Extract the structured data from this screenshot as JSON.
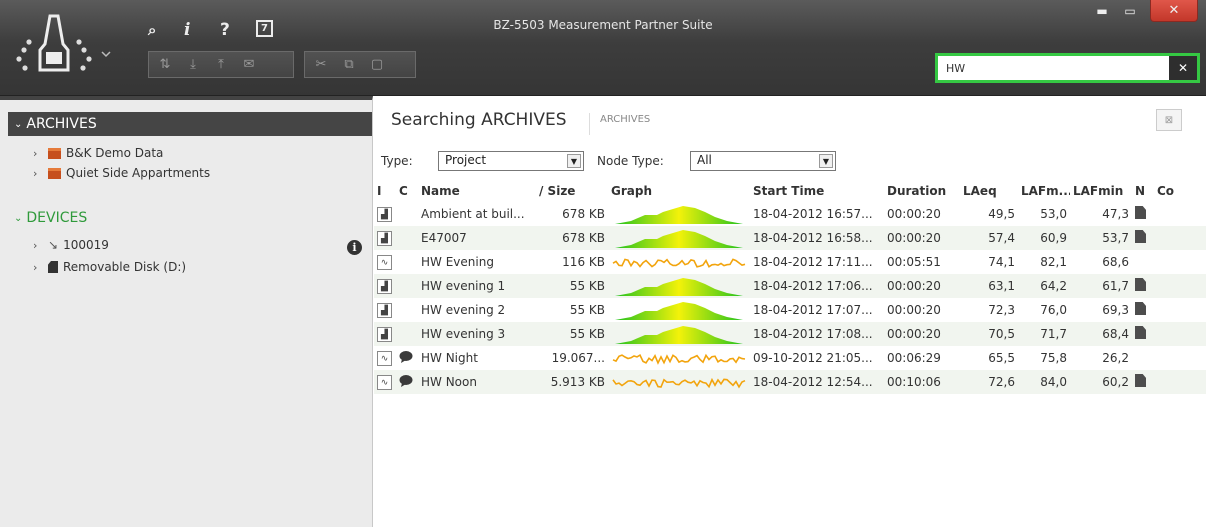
{
  "window": {
    "title": "BZ-5503 Measurement Partner Suite",
    "min_label": "‒",
    "max_label": "▫",
    "close_label": "✕"
  },
  "titlebar_icons": {
    "feedback": "feedback-icon",
    "info": "i",
    "help": "?",
    "calculator": "🖩"
  },
  "toolbar": {
    "group1": [
      "transfer-icon",
      "download-icon",
      "upload-icon",
      "email-icon"
    ],
    "group2": [
      "cut-icon",
      "copy-icon",
      "paste-icon"
    ]
  },
  "search": {
    "value": "HW",
    "clear_label": "✕"
  },
  "left": {
    "archives_label": "ARCHIVES",
    "archives": [
      "B&K Demo Data",
      "Quiet Side Appartments"
    ],
    "devices_label": "DEVICES",
    "devices": [
      "100019",
      "Removable Disk (D:)"
    ]
  },
  "right": {
    "heading": "Searching ARCHIVES",
    "scope": "ARCHIVES",
    "type_label": "Type:",
    "type_value": "Project",
    "node_type_label": "Node Type:",
    "node_type_value": "All",
    "columns": [
      "I",
      "C",
      "Name",
      "/ Size",
      "Graph",
      "Start Time",
      "Duration",
      "LAeq",
      "LAFm...",
      "LAFmin",
      "N",
      "Co"
    ],
    "rows": [
      {
        "icon": "bar",
        "comment": false,
        "name": "Ambient at buil...",
        "size": "678 KB",
        "graph": "mound",
        "start": "18-04-2012 16:57...",
        "duration": "00:00:20",
        "laeq": "49,5",
        "lafmax": "53,0",
        "lafmin": "47,3",
        "note": true
      },
      {
        "icon": "bar",
        "comment": false,
        "name": "E47007",
        "size": "678 KB",
        "graph": "mound",
        "start": "18-04-2012 16:58...",
        "duration": "00:00:20",
        "laeq": "57,4",
        "lafmax": "60,9",
        "lafmin": "53,7",
        "note": true
      },
      {
        "icon": "wave",
        "comment": false,
        "name": "HW Evening",
        "size": "116 KB",
        "graph": "trace",
        "start": "18-04-2012 17:11...",
        "duration": "00:05:51",
        "laeq": "74,1",
        "lafmax": "82,1",
        "lafmin": "68,6",
        "note": false
      },
      {
        "icon": "bar",
        "comment": false,
        "name": "HW evening 1",
        "size": "55 KB",
        "graph": "mound",
        "start": "18-04-2012 17:06...",
        "duration": "00:00:20",
        "laeq": "63,1",
        "lafmax": "64,2",
        "lafmin": "61,7",
        "note": true
      },
      {
        "icon": "bar",
        "comment": false,
        "name": "HW evening 2",
        "size": "55 KB",
        "graph": "mound",
        "start": "18-04-2012 17:07...",
        "duration": "00:00:20",
        "laeq": "72,3",
        "lafmax": "76,0",
        "lafmin": "69,3",
        "note": true
      },
      {
        "icon": "bar",
        "comment": false,
        "name": "HW evening 3",
        "size": "55 KB",
        "graph": "mound",
        "start": "18-04-2012 17:08...",
        "duration": "00:00:20",
        "laeq": "70,5",
        "lafmax": "71,7",
        "lafmin": "68,4",
        "note": true
      },
      {
        "icon": "wave",
        "comment": true,
        "name": "HW Night",
        "size": "19.067...",
        "graph": "trace",
        "start": "09-10-2012 21:05...",
        "duration": "00:06:29",
        "laeq": "65,5",
        "lafmax": "75,8",
        "lafmin": "26,2",
        "note": false
      },
      {
        "icon": "wave",
        "comment": true,
        "name": "HW Noon",
        "size": "5.913 KB",
        "graph": "trace",
        "start": "18-04-2012 12:54...",
        "duration": "00:10:06",
        "laeq": "72,6",
        "lafmax": "84,0",
        "lafmin": "60,2",
        "note": true
      }
    ]
  },
  "colors": {
    "accent_green": "#35c843",
    "devices_green": "#2f9a3b",
    "archive_orange": "#c64f1d",
    "graph_green": "#22c21e",
    "graph_yellow": "#f3f20a",
    "trace_orange": "#f2a40d"
  }
}
